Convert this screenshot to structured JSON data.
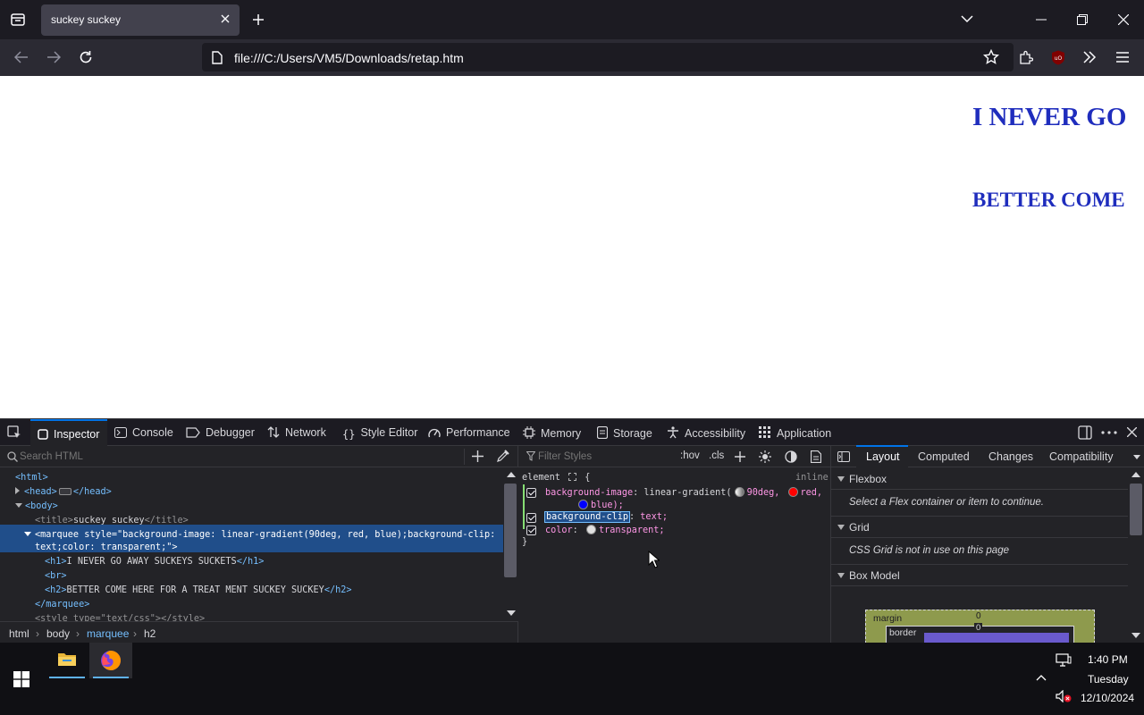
{
  "browser": {
    "tab_title": "suckey suckey",
    "url": "file:///C:/Users/VM5/Downloads/retap.htm"
  },
  "page": {
    "h1": "I NEVER GO",
    "h2": "BETTER COME"
  },
  "devtools": {
    "tabs": [
      "Inspector",
      "Console",
      "Debugger",
      "Network",
      "Style Editor",
      "Performance",
      "Memory",
      "Storage",
      "Accessibility",
      "Application"
    ],
    "search_placeholder": "Search HTML",
    "markup": {
      "html_open": "<html>",
      "head_open": "<head>",
      "head_close": "</head>",
      "body_open": "<body>",
      "title_open": "<title>",
      "title_text": "suckey suckey",
      "title_close": "</title>",
      "marquee_line1": "<marquee style=\"background-image: linear-gradient(90deg, red, blue);background-clip:",
      "marquee_line2": "text;color: transparent;\">",
      "h1_open": "<h1>",
      "h1_text": "I NEVER GO AWAY SUCKEYS SUCKETS",
      "h1_close": "</h1>",
      "br": "<br>",
      "h2_open": "<h2>",
      "h2_text": "BETTER COME HERE FOR A TREAT MENT SUCKEY SUCKEY",
      "h2_close": "</h2>",
      "marquee_close": "</marquee>",
      "style_open": "<style type=\"text/css\">",
      "style_close": "</style>"
    },
    "breadcrumbs": [
      "html",
      "body",
      "marquee",
      "h2"
    ],
    "rules": {
      "filter_placeholder": "Filter Styles",
      "hov": ":hov",
      "cls": ".cls",
      "selector": "element",
      "brace_open": "{",
      "source": "inline",
      "decl1_prop": "background-image",
      "decl1_val_a": "linear-gradient(",
      "decl1_val_b": "90deg,",
      "decl1_val_c": "red,",
      "decl1_val_d": "blue);",
      "decl2_prop": "background-clip",
      "decl2_val": "text;",
      "decl3_prop": "color",
      "decl3_val": "transparent;",
      "brace_close": "}"
    },
    "layout_tabs": [
      "Layout",
      "Computed",
      "Changes",
      "Compatibility"
    ],
    "layout": {
      "flexbox_title": "Flexbox",
      "flexbox_note": "Select a Flex container or item to continue.",
      "grid_title": "Grid",
      "grid_note": "CSS Grid is not in use on this page",
      "boxmodel_title": "Box Model",
      "margin_label": "margin",
      "margin_value": "0",
      "border_label": "border",
      "border_value": "0"
    }
  },
  "taskbar": {
    "time": "1:40 PM",
    "day": "Tuesday",
    "date": "12/10/2024"
  },
  "colors": {
    "accent": "#0074e8",
    "h1": "#1f2dbd"
  }
}
